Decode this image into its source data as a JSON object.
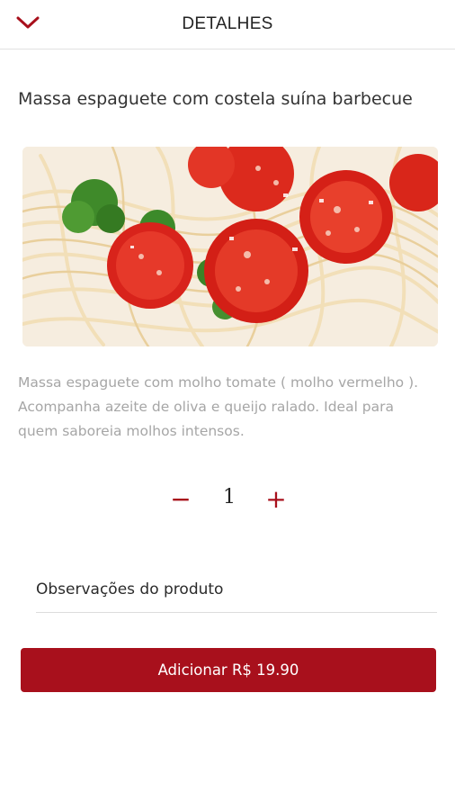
{
  "header": {
    "title": "DETALHES",
    "back_icon": "chevron-down-icon"
  },
  "product": {
    "name": "Massa espaguete com costela suína barbecue",
    "description": "Massa espaguete com molho tomate ( molho vermelho ). Acompanha azeite de oliva e queijo ralado. Ideal para quem saboreia molhos intensos.",
    "image_subject": "spaghetti with cherry tomatoes and broccoli"
  },
  "quantity": {
    "minus_label": "−",
    "value": "1",
    "plus_label": "+"
  },
  "observations": {
    "placeholder": "Observações do produto",
    "value": ""
  },
  "add_button": {
    "label": "Adicionar R$ 19.90"
  },
  "colors": {
    "accent": "#a8101c",
    "description_text": "#a6a6a6",
    "divider": "#e1e1e1"
  }
}
